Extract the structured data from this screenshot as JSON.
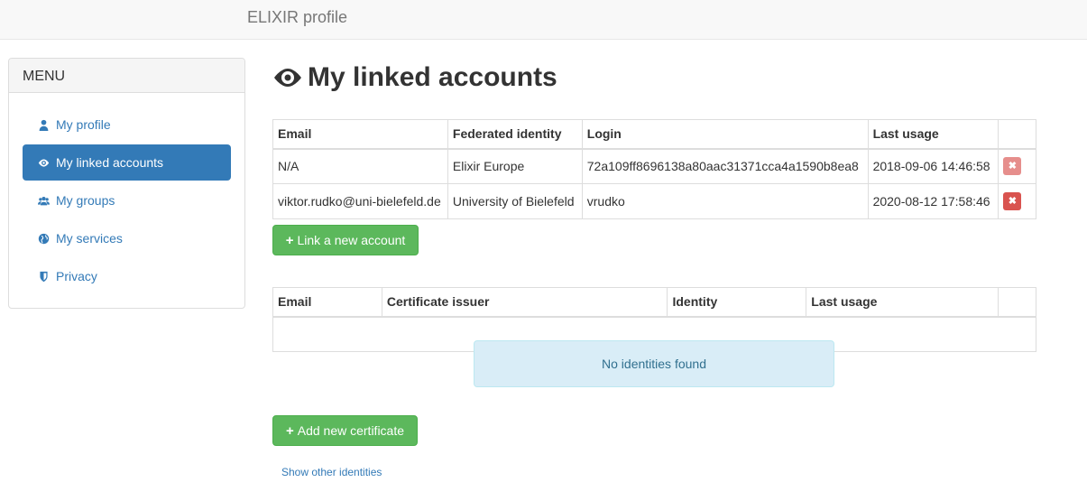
{
  "navbar": {
    "brand": "ELIXIR profile"
  },
  "menu": {
    "heading": "MENU",
    "items": [
      {
        "label": "My profile",
        "icon": "user-icon"
      },
      {
        "label": "My linked accounts",
        "icon": "eye-icon",
        "active": true
      },
      {
        "label": "My groups",
        "icon": "users-icon"
      },
      {
        "label": "My services",
        "icon": "globe-icon"
      },
      {
        "label": "Privacy",
        "icon": "shield-icon"
      }
    ]
  },
  "page": {
    "title": "My linked accounts",
    "title_icon": "eye-icon"
  },
  "accounts_table": {
    "headers": [
      "Email",
      "Federated identity",
      "Login",
      "Last usage"
    ],
    "rows": [
      {
        "email": "N/A",
        "identity": "Elixir Europe",
        "login": "72a109ff8696138a80aac31371cca4a1590b8ea8",
        "last_usage": "2018-09-06 14:46:58",
        "delete_disabled": true
      },
      {
        "email": "viktor.rudko@uni-bielefeld.de",
        "identity": "University of Bielefeld",
        "login": "vrudko",
        "last_usage": "2020-08-12 17:58:46",
        "delete_disabled": false
      }
    ],
    "link_button": "Link a new account"
  },
  "certs_table": {
    "headers": [
      "Email",
      "Certificate issuer",
      "Identity",
      "Last usage"
    ],
    "empty_message": "No identities found",
    "add_button": "Add new certificate"
  },
  "show_other": "Show other identities",
  "colors": {
    "primary": "#337ab7",
    "success": "#5cb85c",
    "danger": "#d9534f",
    "info_bg": "#d9edf7"
  }
}
